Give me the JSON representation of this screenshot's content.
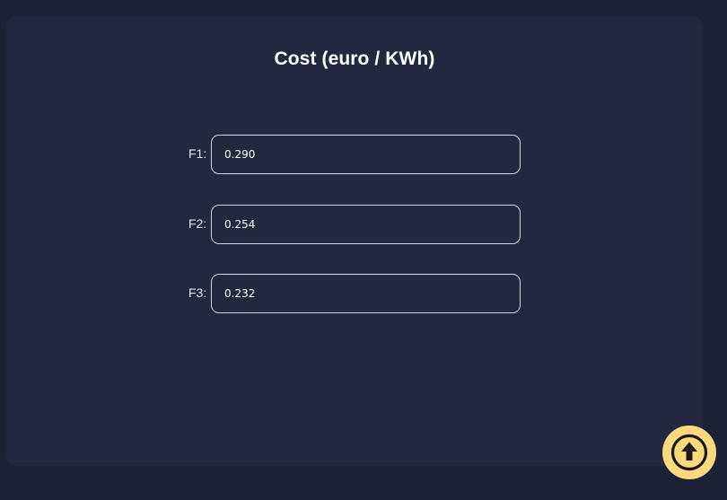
{
  "header": {
    "title": "Cost (euro / KWh)"
  },
  "fields": [
    {
      "label": "F1:",
      "value": "0.290"
    },
    {
      "label": "F2:",
      "value": "0.254"
    },
    {
      "label": "F3:",
      "value": "0.232"
    }
  ],
  "upload_button": {
    "icon": "arrow-up-circle-icon",
    "background_color": "#fcd97c",
    "icon_color": "#1a1a1a"
  },
  "colors": {
    "page_background": "#1c2236",
    "panel_background": "#222840",
    "input_border": "#d4d6de"
  }
}
